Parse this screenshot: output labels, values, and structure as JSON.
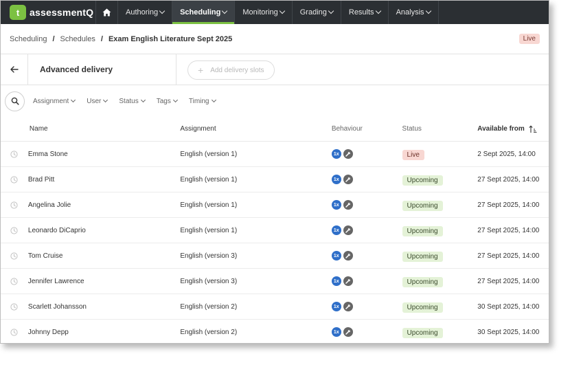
{
  "nav": {
    "logo_letter": "t",
    "logo_text": "assessmentQ",
    "items": [
      {
        "label": "Authoring",
        "active": false
      },
      {
        "label": "Scheduling",
        "active": true
      },
      {
        "label": "Monitoring",
        "active": false
      },
      {
        "label": "Grading",
        "active": false
      },
      {
        "label": "Results",
        "active": false
      },
      {
        "label": "Analysis",
        "active": false
      }
    ]
  },
  "breadcrumb": {
    "items": [
      "Scheduling",
      "Schedules",
      "Exam English Literature Sept 2025"
    ],
    "status": "Live"
  },
  "section": {
    "title": "Advanced delivery",
    "add_button": "Add delivery slots"
  },
  "filters": [
    "Assignment",
    "User",
    "Status",
    "Tags",
    "Timing"
  ],
  "table": {
    "headers": {
      "name": "Name",
      "assignment": "Assignment",
      "behaviour": "Behaviour",
      "status": "Status",
      "available_from": "Available from"
    },
    "behaviour_badge": "1x",
    "rows": [
      {
        "name": "Emma Stone",
        "assignment": "English (version 1)",
        "status": "Live",
        "available": "2 Sept 2025, 14:00"
      },
      {
        "name": "Brad Pitt",
        "assignment": "English (version 1)",
        "status": "Upcoming",
        "available": "27 Sept 2025, 14:00"
      },
      {
        "name": "Angelina Jolie",
        "assignment": "English (version 1)",
        "status": "Upcoming",
        "available": "27 Sept 2025, 14:00"
      },
      {
        "name": "Leonardo DiCaprio",
        "assignment": "English (version 1)",
        "status": "Upcoming",
        "available": "27 Sept 2025, 14:00"
      },
      {
        "name": "Tom Cruise",
        "assignment": "English (version 3)",
        "status": "Upcoming",
        "available": "27 Sept 2025, 14:00"
      },
      {
        "name": "Jennifer Lawrence",
        "assignment": "English (version 3)",
        "status": "Upcoming",
        "available": "27 Sept 2025, 14:00"
      },
      {
        "name": "Scarlett Johansson",
        "assignment": "English (version 2)",
        "status": "Upcoming",
        "available": "30 Sept 2025, 14:00"
      },
      {
        "name": "Johnny Depp",
        "assignment": "English (version 2)",
        "status": "Upcoming",
        "available": "30 Sept 2025, 14:00"
      }
    ]
  },
  "colors": {
    "nav_bg": "#2b2f33",
    "accent": "#7cc142",
    "live_bg": "#f8d7d2",
    "upcoming_bg": "#e4f2d7",
    "badge_blue": "#2f6fc9"
  }
}
